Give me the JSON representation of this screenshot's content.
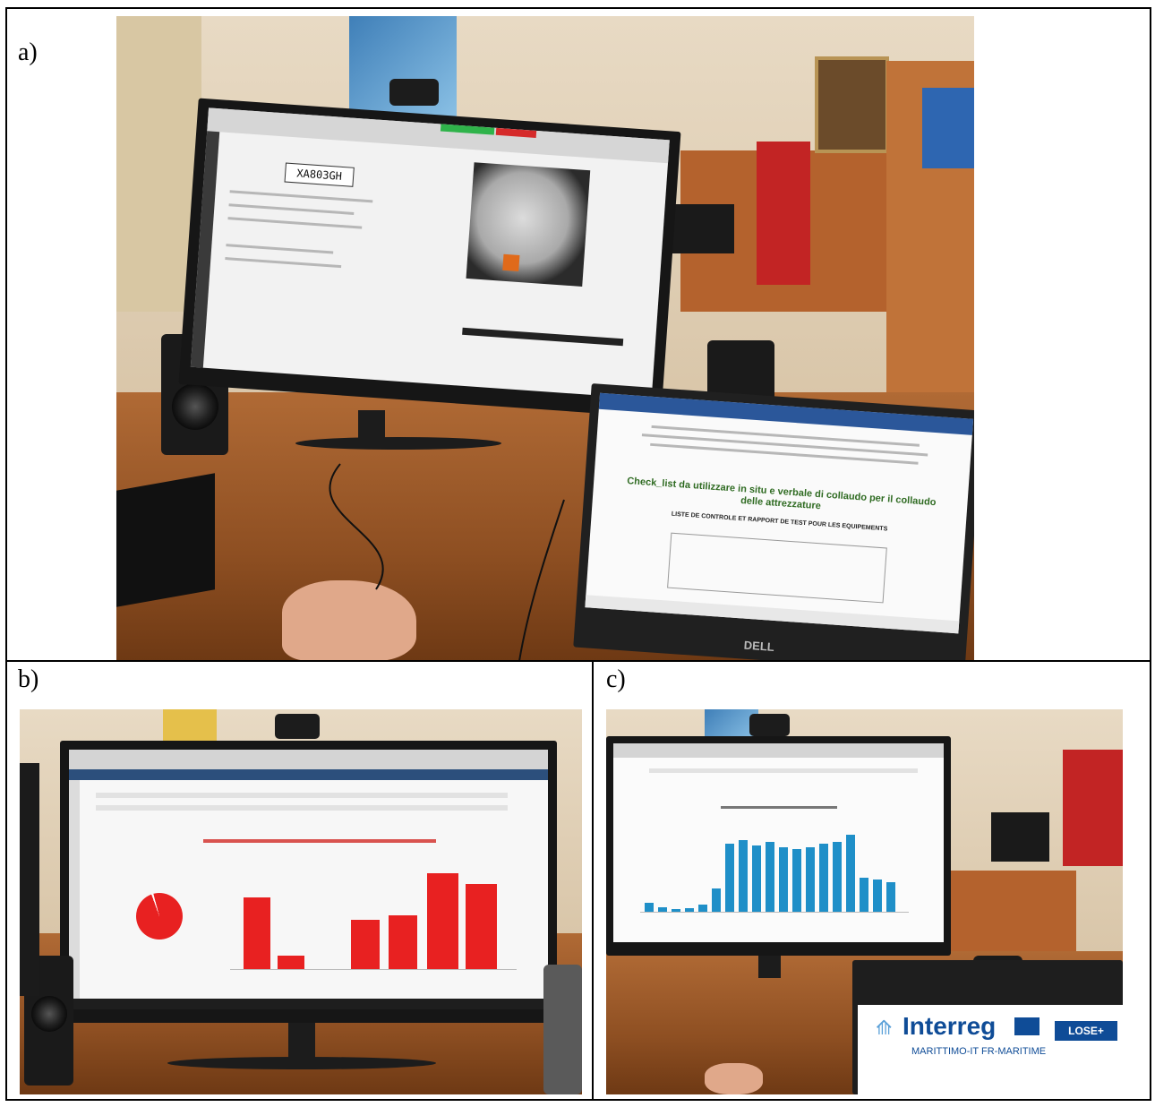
{
  "panels": [
    {
      "label": "a)"
    },
    {
      "label": "b)"
    },
    {
      "label": "c)"
    }
  ],
  "photo_a": {
    "plate": "XA803GH",
    "doc_heading": "Check_list da utilizzare in situ e verbale di collaudo per il collaudo delle attrezzature",
    "doc_subheading": "LISTE DE CONTROLE ET RAPPORT DE TEST POUR LES EQUIPEMENTS",
    "laptop_brand": "DELL"
  },
  "photo_c": {
    "logo_text": "Interreg",
    "logo_subtext": "MARITTIMO-IT FR-MARITIME",
    "project_badge": "LOSE+"
  },
  "colors": {
    "chart_red": "#e82121",
    "chart_blue": "#1f8fc8",
    "desk_wood": "#a25f2c",
    "interreg_blue": "#0f4c97"
  }
}
